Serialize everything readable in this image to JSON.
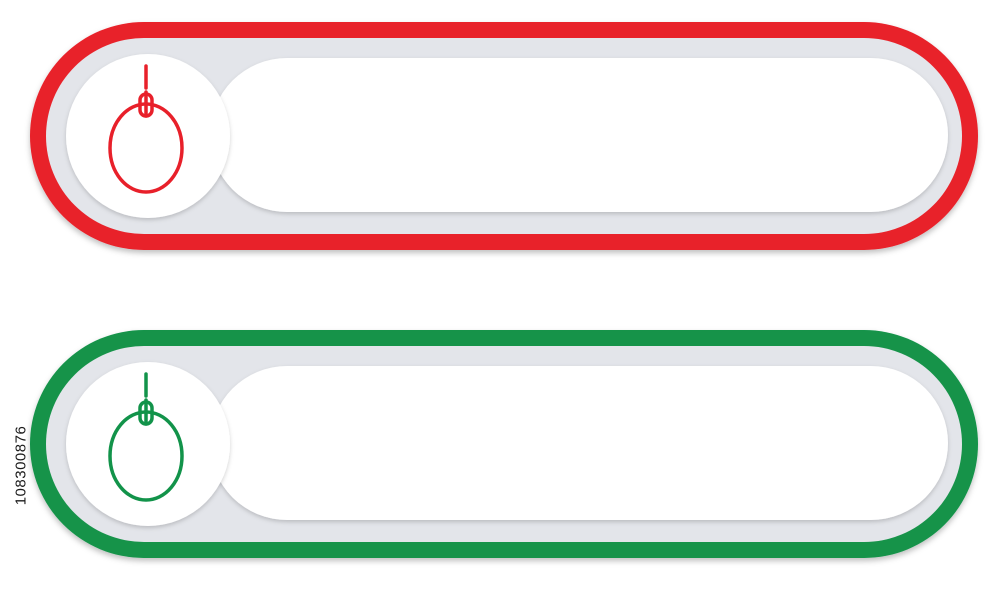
{
  "colors": {
    "background": "#ffffff",
    "red_frame": "#e8202a",
    "green_frame": "#12934a",
    "inner_gray": "#e3e5ea",
    "inner_shadow": "#c9ccd3",
    "field_white": "#ffffff"
  },
  "buttons": [
    {
      "frame_color": "#e8202a",
      "icon": "computer-mouse-icon",
      "field_value": ""
    },
    {
      "frame_color": "#12934a",
      "icon": "computer-mouse-icon",
      "field_value": ""
    }
  ],
  "side_id": "108300876"
}
